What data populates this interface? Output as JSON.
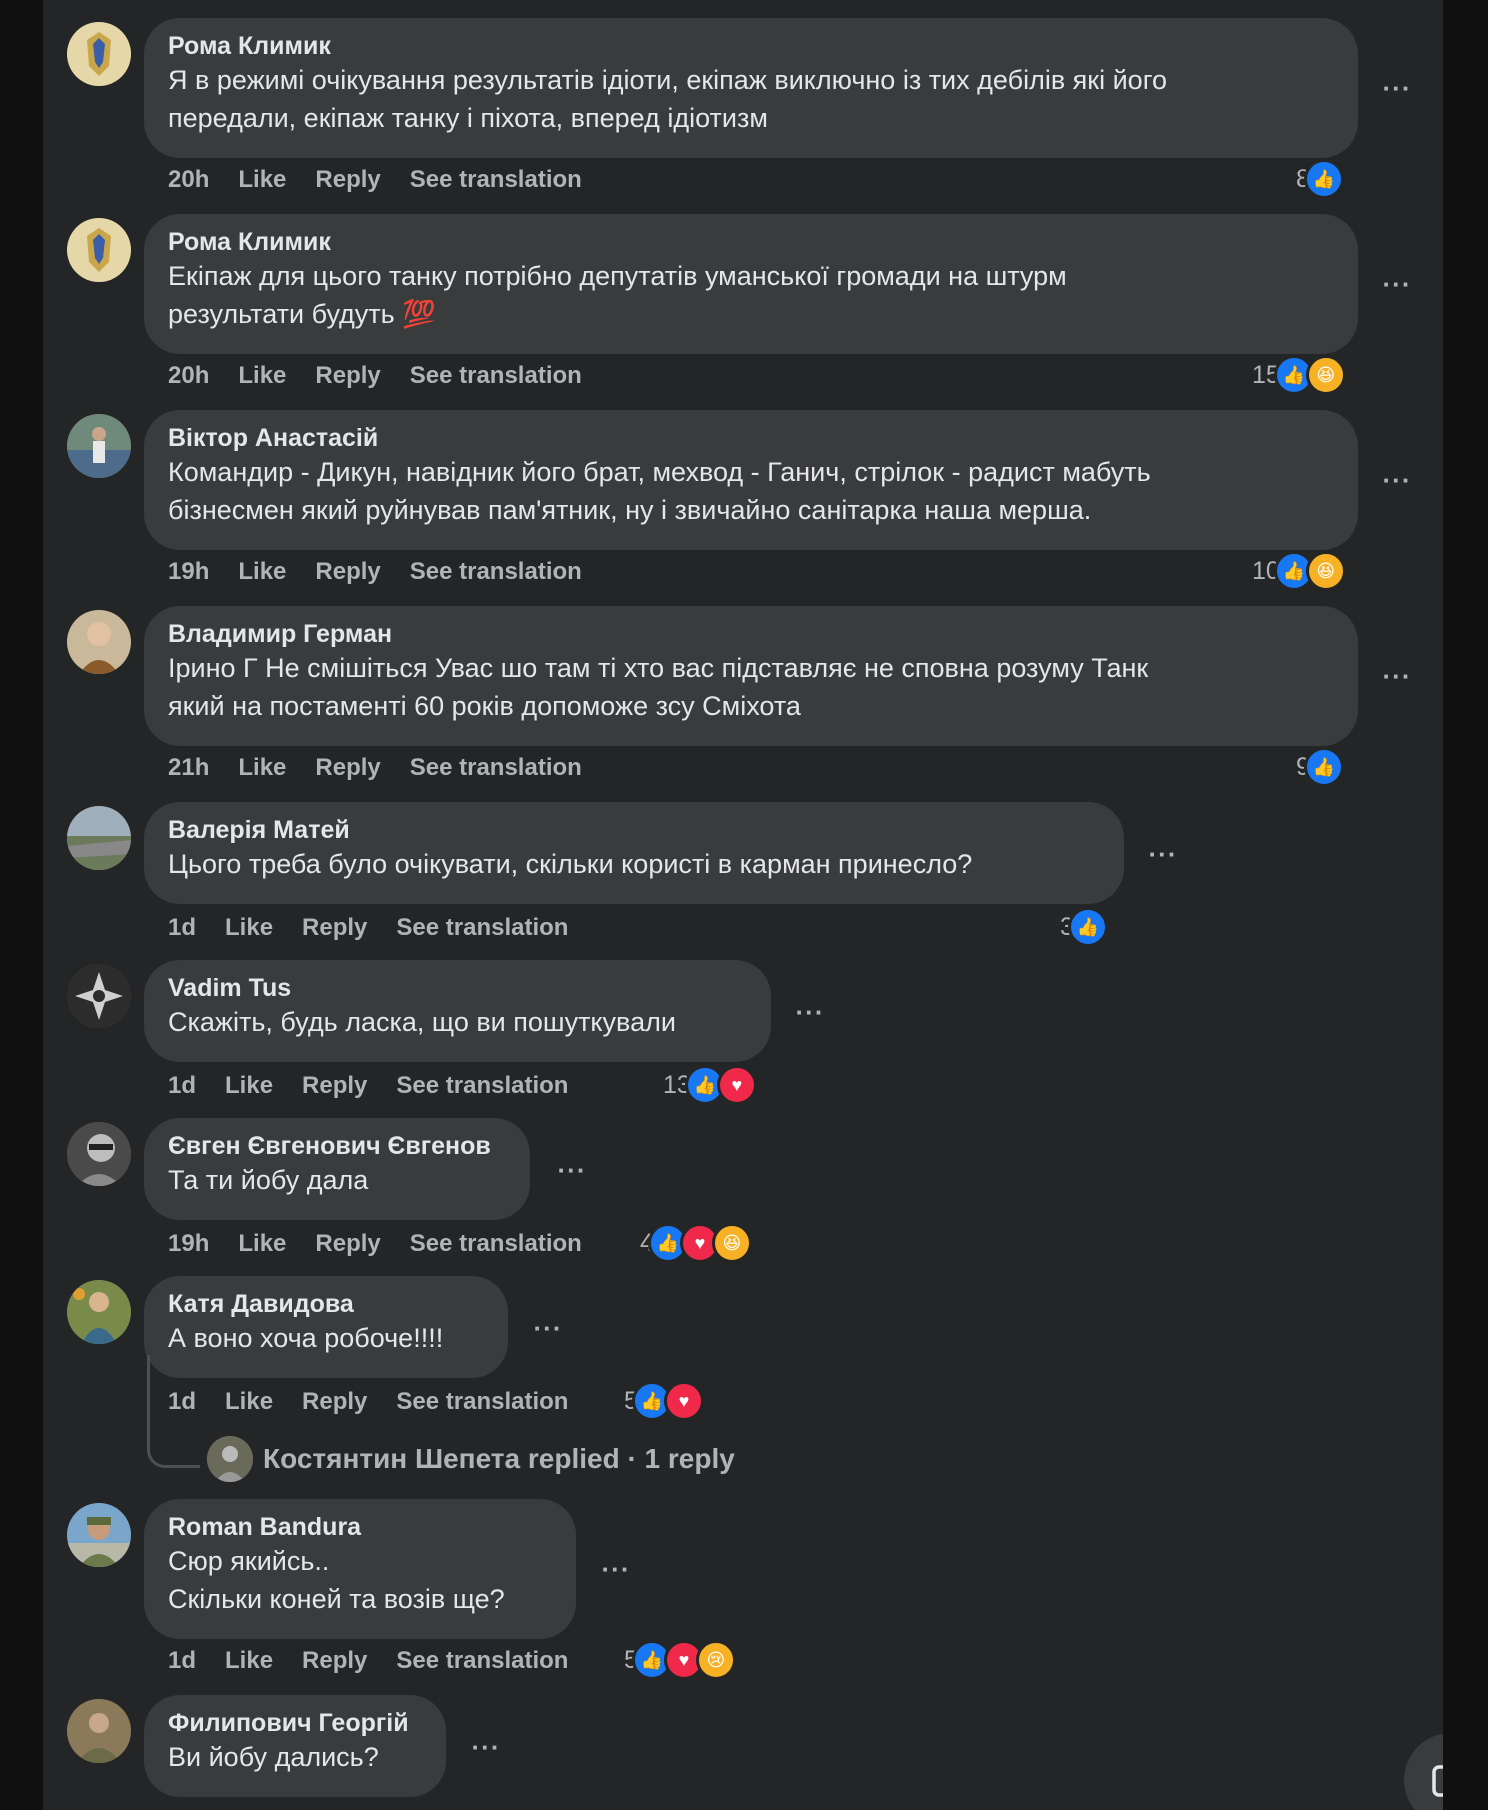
{
  "colors": {
    "background": "#101010",
    "panel": "#242526",
    "bubble": "#3a3b3c",
    "text": "#e4e6eb",
    "secondary": "#b0b3b8",
    "like": "#1877f2",
    "love": "#f02849",
    "haha": "#f7b125"
  },
  "action_labels": {
    "like": "Like",
    "reply": "Reply",
    "translate": "See translation"
  },
  "comments": [
    {
      "author": "Рома Климик",
      "text": "Я в режимі очікування результатів ідіоти, екіпаж виключно із тих дебілів які його\nпередали, екіпаж танку і піхота, вперед ідіотизм",
      "time": "20h",
      "reaction_count": "8",
      "reactions": [
        "like"
      ]
    },
    {
      "author": "Рома Климик",
      "text": "Екіпаж для цього танку потрібно депутатів уманської громади на штурм\nрезультати будуть 💯",
      "time": "20h",
      "reaction_count": "15",
      "reactions": [
        "like",
        "haha"
      ]
    },
    {
      "author": "Віктор Анастасій",
      "text": "Командир - Дикун, навідник його брат, мехвод - Ганич, стрілок - радист мабуть\nбізнесмен який руйнував пам'ятник, ну і звичайно санітарка наша мерша.",
      "time": "19h",
      "reaction_count": "10",
      "reactions": [
        "like",
        "haha"
      ]
    },
    {
      "author": "Владимир Герман",
      "text": "Ірино Г Не смішіться Увас шо там ті хто вас підставляє не сповна розуму Танк\nякий на постаменті 60 років допоможе зсу Сміхота",
      "time": "21h",
      "reaction_count": "9",
      "reactions": [
        "like"
      ]
    },
    {
      "author": "Валерія Матей",
      "text": "Цього треба було очікувати, скільки користі в карман принесло?",
      "time": "1d",
      "reaction_count": "3",
      "reactions": [
        "like"
      ]
    },
    {
      "author": "Vadim Tus",
      "text": "Скажіть, будь ласка, що ви пошуткували",
      "time": "1d",
      "reaction_count": "13",
      "reactions": [
        "like",
        "love"
      ]
    },
    {
      "author": "Євген Євгенович Євгенов",
      "text": "Та ти йобу дала",
      "time": "19h",
      "reaction_count": "4",
      "reactions": [
        "like",
        "love",
        "haha"
      ]
    },
    {
      "author": "Катя Давидова",
      "text": "А воно хоча робоче!!!!",
      "time": "1d",
      "reaction_count": "5",
      "reactions": [
        "like",
        "love"
      ]
    },
    {
      "author": "Roman Bandura",
      "text": "Сюр якийсь..\nСкільки коней та возів ще?",
      "time": "1d",
      "reaction_count": "5",
      "reactions": [
        "like",
        "love",
        "sad"
      ]
    },
    {
      "author": "Филипович Георгій",
      "text": "Ви йобу дались?",
      "time": "",
      "reaction_count": "",
      "reactions": []
    }
  ],
  "replies_summary": {
    "text": "Костянтин Шепета replied · 1 reply"
  },
  "fab_icon": "edit-icon"
}
